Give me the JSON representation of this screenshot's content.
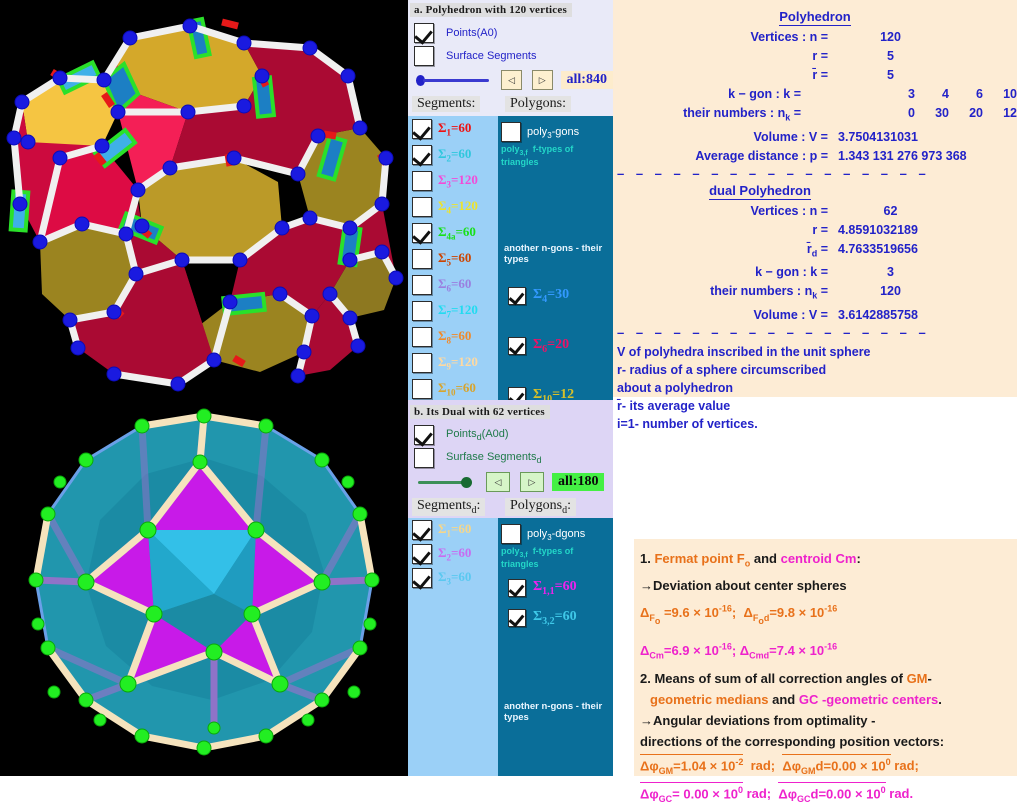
{
  "panels": {
    "top": {
      "title": "a. Polyhedron with 120 vertices",
      "points_label": "Points(A0)",
      "surface_label": "Surface Segments",
      "all_badge": "all:840",
      "prev_arrow": "◁",
      "next_arrow": "▷",
      "segments_header": "Segments:",
      "polygons_header": "Polygons:",
      "poly_gons_label": "poly3-gons",
      "poly_ftypes_label": "poly3,f  f-types of triangles",
      "another_label": "another n-gons -  their types",
      "segments": [
        {
          "label": "Σ1=60",
          "checked": true,
          "color": "#ee1111"
        },
        {
          "label": "Σ2=60",
          "checked": true,
          "color": "#2fc7dd"
        },
        {
          "label": "Σ3=120",
          "checked": false,
          "color": "#f24bd8"
        },
        {
          "label": "Σ4=120",
          "checked": false,
          "color": "#ede32c"
        },
        {
          "label": "Σ4a=60",
          "checked": true,
          "color": "#18e018"
        },
        {
          "label": "Σ5=60",
          "checked": false,
          "color": "#cc4400"
        },
        {
          "label": "Σ6=60",
          "checked": false,
          "color": "#9a7fe0"
        },
        {
          "label": "Σ7=120",
          "checked": false,
          "color": "#22dbf0"
        },
        {
          "label": "Σ8=60",
          "checked": false,
          "color": "#f08a2a"
        },
        {
          "label": "Σ9=120",
          "checked": false,
          "color": "#ffd9a0"
        },
        {
          "label": "Σ10=60",
          "checked": false,
          "color": "#d8a42c"
        }
      ],
      "ngons": [
        {
          "label": "Σ4=30",
          "checked": true,
          "color": "#3399ff"
        },
        {
          "label": "Σ6=20",
          "checked": true,
          "color": "#ee1166"
        },
        {
          "label": "Σ10=12",
          "checked": true,
          "color": "#d8c028"
        }
      ],
      "polygon_checkbox_checked": false
    },
    "bottom": {
      "title": "b. Its Dual with 62  vertices",
      "points_label": "Pointsd(A0d)",
      "surface_label": "Surfase Segmentsd",
      "all_badge": "all:180",
      "prev_arrow": "◁",
      "next_arrow": "▷",
      "segments_header": "Segmentsd:",
      "polygons_header": "Polygonsd:",
      "poly_gons_label": "poly3-dgons",
      "poly_ftypes_label": "poly3,f  f-types of triangles",
      "another_label": "another n-gons -  their types",
      "segments": [
        {
          "label": "Σ1=60",
          "checked": true,
          "color": "#f6d68a"
        },
        {
          "label": "Σ2=60",
          "checked": true,
          "color": "#c86cf0"
        },
        {
          "label": "Σ3=60",
          "checked": true,
          "color": "#5ac8f0"
        }
      ],
      "ngons": [
        {
          "label": "Σ1,1=60",
          "checked": true,
          "color": "#ee22ee"
        },
        {
          "label": "Σ3,2=60",
          "checked": true,
          "color": "#3fc8e8"
        }
      ],
      "polygon_checkbox_checked": false
    }
  },
  "info_main": {
    "title_polyhedron": "Polyhedron",
    "rows_polyhedron": [
      {
        "key": "Vertices : n =",
        "value": "120",
        "mode": "ctr"
      },
      {
        "key": "r =",
        "value": "5",
        "mode": "ctr"
      },
      {
        "key": "r̄ =",
        "value": "5",
        "mode": "ctr"
      },
      {
        "key": "k − gon : k =",
        "cells": [
          "3",
          "4",
          "6",
          "10"
        ],
        "mode": "cells"
      },
      {
        "key": "their numbers : nk =",
        "cells": [
          "0",
          "30",
          "20",
          "12"
        ],
        "mode": "cells"
      },
      {
        "key": "Volume : V =",
        "value": "3.7504131031",
        "mode": "left"
      },
      {
        "key": "Average distance : p =",
        "value": "1.343 131 276 973 368",
        "mode": "left"
      }
    ],
    "divider": "– – – – – – – – – – – – – – – – –",
    "title_dual": "dual Polyhedron",
    "rows_dual": [
      {
        "key": "Vertices : n =",
        "value": "62",
        "mode": "ctr"
      },
      {
        "key": "r =",
        "value": "4.8591032189",
        "mode": "left"
      },
      {
        "key": "r̄d =",
        "value": "4.7633519656",
        "mode": "left"
      },
      {
        "key": "k − gon : k =",
        "value": "3",
        "mode": "ctr"
      },
      {
        "key": "their numbers : nk =",
        "value": "120",
        "mode": "ctr"
      },
      {
        "key": "Volume : V =",
        "value": "3.6142885758",
        "mode": "left"
      }
    ],
    "notes": [
      "V of polyhedra inscribed in the unit sphere",
      " r-  radius of a sphere circumscribed",
      "     about a polyhedron",
      " r̄-  its average value",
      " i=1-  number of  vertices."
    ]
  },
  "info_notes": {
    "line1_pre": "1. ",
    "line1_fermat": "Fermat point  Fo",
    "line1_and": " and  ",
    "line1_centroid": "centroid Cm",
    "line1_post": ":",
    "line2": "→Deviation about center spheres",
    "line3_a": "ΔFo =9.6 × 10-16;",
    "line3_b": "ΔFod=9.8 × 10-16",
    "line4_a": "ΔCm=6.9 × 10-16;",
    "line4_b": "ΔCmd=7.4 × 10-16",
    "line5_pre": "2. Means of sum of all correction angles of ",
    "line5_gm": "GM",
    "line5_post": "-",
    "line6_a": "geometric medians",
    "line6_and": " and ",
    "line6_gc": "GC",
    "line6_b": " -geometric centers",
    "line6_dot": ".",
    "line7": " →Angular deviations from optimality -",
    "line8": "directions of the corresponding position vectors:",
    "line9_a": "ΔφGM=1.04 × 10-2  rad;",
    "line9_b": "ΔφGMd=0.00 × 100 rad;",
    "line10_a": "ΔφGC= 0.00 × 100 rad;",
    "line10_b": "ΔφGCd=0.00 × 100 rad."
  }
}
